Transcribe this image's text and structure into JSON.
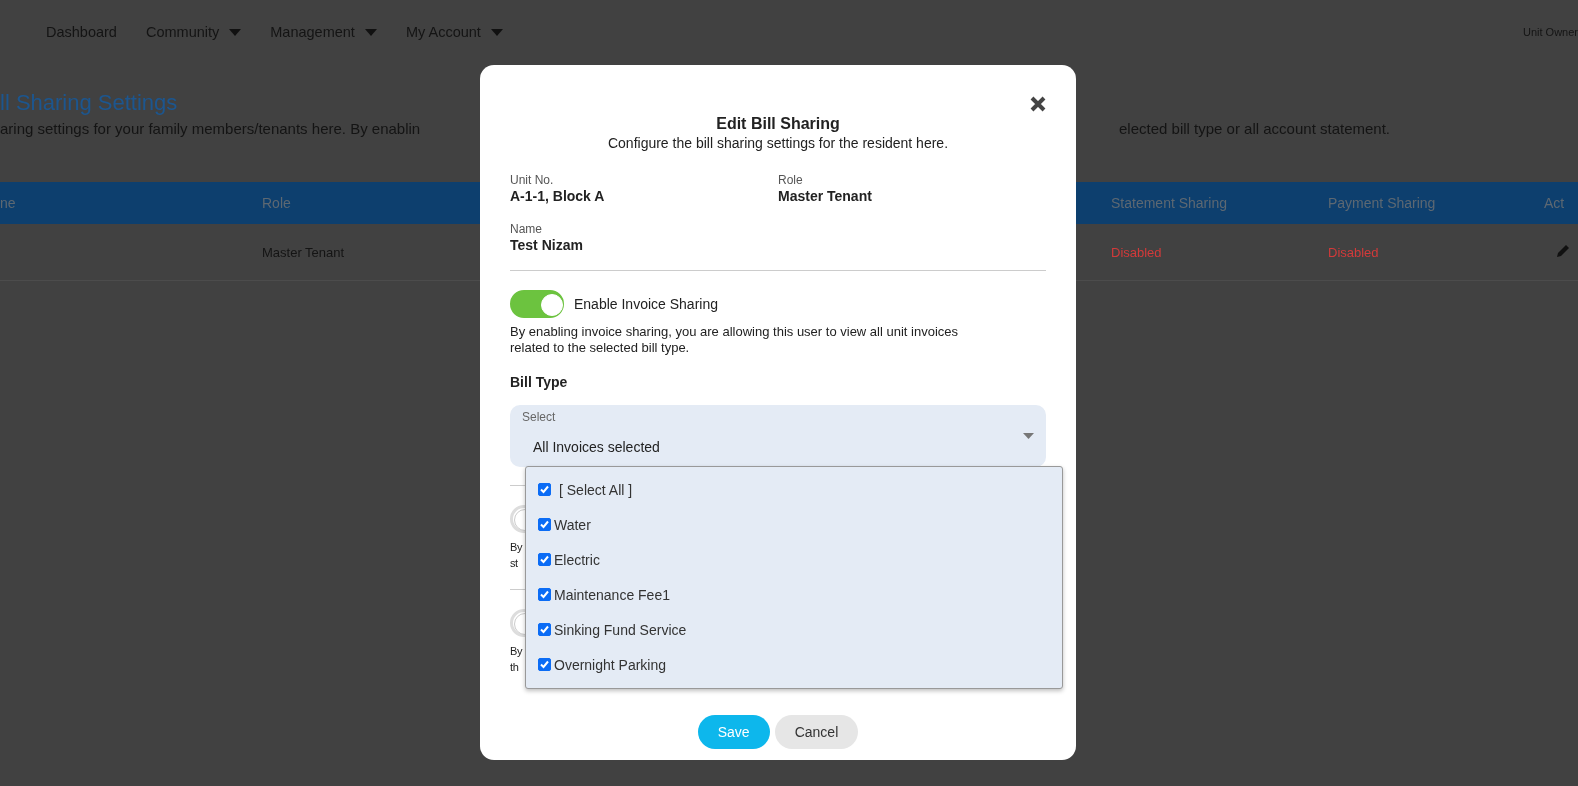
{
  "nav": {
    "items": [
      {
        "label": "Dashboard",
        "dropdown": false
      },
      {
        "label": "Community",
        "dropdown": true
      },
      {
        "label": "Management",
        "dropdown": true
      },
      {
        "label": "My Account",
        "dropdown": true
      }
    ],
    "user": "Unit Owner"
  },
  "page": {
    "title": "ll Sharing Settings",
    "description_left": "aring settings for your family members/tenants here. By enablin",
    "description_right": "elected bill type or all account statement."
  },
  "table": {
    "columns": [
      "ne",
      "Role",
      "Statement Sharing",
      "Payment Sharing",
      "Act"
    ],
    "rows": [
      {
        "role": "Master Tenant",
        "statement_sharing": {
          "text": "Disabled",
          "enabled": false
        },
        "payment_sharing": {
          "text": "Disabled",
          "enabled": false
        }
      }
    ]
  },
  "modal": {
    "title": "Edit Bill Sharing",
    "subtitle": "Configure the bill sharing settings for the resident here.",
    "fields": [
      {
        "label": "Unit No.",
        "value": "A-1-1, Block A"
      },
      {
        "label": "Role",
        "value": "Master Tenant"
      },
      {
        "label": "Name",
        "value": "Test Nizam"
      }
    ],
    "sharing": [
      {
        "label": "Enable Invoice Sharing",
        "on": true,
        "description": "By enabling invoice sharing, you are allowing this user to view all unit invoices related to the selected bill type.",
        "bill_type": {
          "label": "Bill Type",
          "select": {
            "label": "Select",
            "value": "All Invoices selected",
            "expanded": true,
            "options": [
              {
                "label": "[ Select All ]",
                "checked": true
              },
              {
                "label": "Water",
                "checked": true
              },
              {
                "label": "Electric",
                "checked": true
              },
              {
                "label": "Maintenance Fee1",
                "checked": true
              },
              {
                "label": "Sinking Fund Service",
                "checked": true
              },
              {
                "label": "Overnight Parking",
                "checked": true
              }
            ]
          }
        }
      },
      {
        "on": false,
        "fragments": [
          "By",
          "st"
        ]
      },
      {
        "on": false,
        "fragments": [
          "By",
          "th"
        ]
      }
    ],
    "buttons": [
      {
        "label": "Save",
        "kind": "primary"
      },
      {
        "label": "Cancel",
        "kind": "secondary"
      }
    ]
  }
}
